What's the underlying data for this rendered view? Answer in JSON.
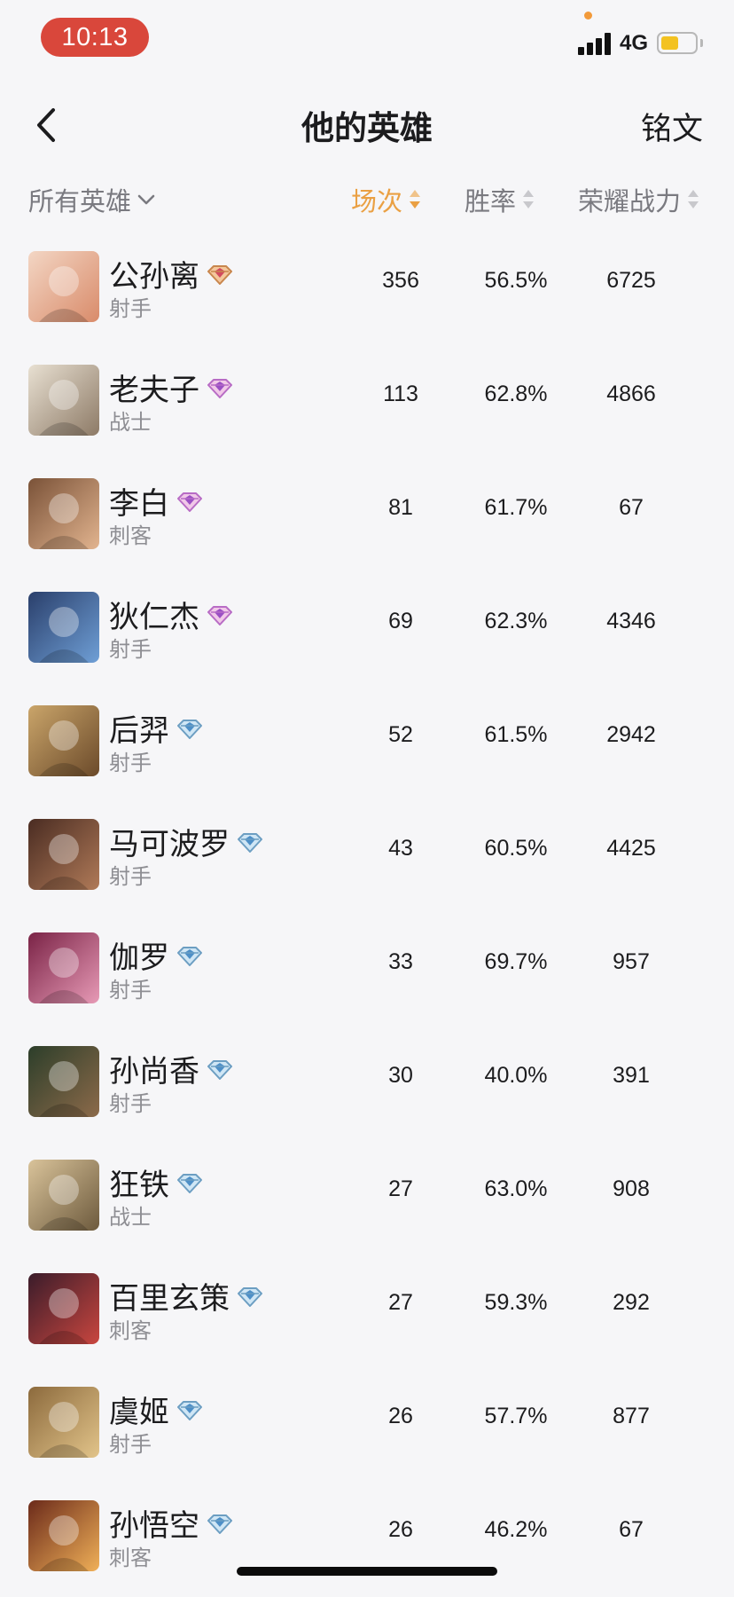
{
  "status": {
    "time": "10:13",
    "network": "4G"
  },
  "nav": {
    "title": "他的英雄",
    "right": "铭文"
  },
  "sort": {
    "filter_label": "所有英雄",
    "columns": [
      {
        "label": "场次",
        "active": true
      },
      {
        "label": "胜率",
        "active": false
      },
      {
        "label": "荣耀战力",
        "active": false
      }
    ]
  },
  "colors": {
    "accent": "#eaa043",
    "status_pill": "#d9473b",
    "battery": "#f3c221"
  },
  "heroes": [
    {
      "name": "公孙离",
      "role": "射手",
      "games": "356",
      "winrate": "56.5%",
      "power": "6725",
      "badge": "gold"
    },
    {
      "name": "老夫子",
      "role": "战士",
      "games": "113",
      "winrate": "62.8%",
      "power": "4866",
      "badge": "purple"
    },
    {
      "name": "李白",
      "role": "刺客",
      "games": "81",
      "winrate": "61.7%",
      "power": "67",
      "badge": "purple"
    },
    {
      "name": "狄仁杰",
      "role": "射手",
      "games": "69",
      "winrate": "62.3%",
      "power": "4346",
      "badge": "purple"
    },
    {
      "name": "后羿",
      "role": "射手",
      "games": "52",
      "winrate": "61.5%",
      "power": "2942",
      "badge": "blue"
    },
    {
      "name": "马可波罗",
      "role": "射手",
      "games": "43",
      "winrate": "60.5%",
      "power": "4425",
      "badge": "blue"
    },
    {
      "name": "伽罗",
      "role": "射手",
      "games": "33",
      "winrate": "69.7%",
      "power": "957",
      "badge": "blue"
    },
    {
      "name": "孙尚香",
      "role": "射手",
      "games": "30",
      "winrate": "40.0%",
      "power": "391",
      "badge": "blue"
    },
    {
      "name": "狂铁",
      "role": "战士",
      "games": "27",
      "winrate": "63.0%",
      "power": "908",
      "badge": "blue"
    },
    {
      "name": "百里玄策",
      "role": "刺客",
      "games": "27",
      "winrate": "59.3%",
      "power": "292",
      "badge": "blue"
    },
    {
      "name": "虞姬",
      "role": "射手",
      "games": "26",
      "winrate": "57.7%",
      "power": "877",
      "badge": "blue"
    },
    {
      "name": "孙悟空",
      "role": "刺客",
      "games": "26",
      "winrate": "46.2%",
      "power": "67",
      "badge": "blue"
    }
  ]
}
